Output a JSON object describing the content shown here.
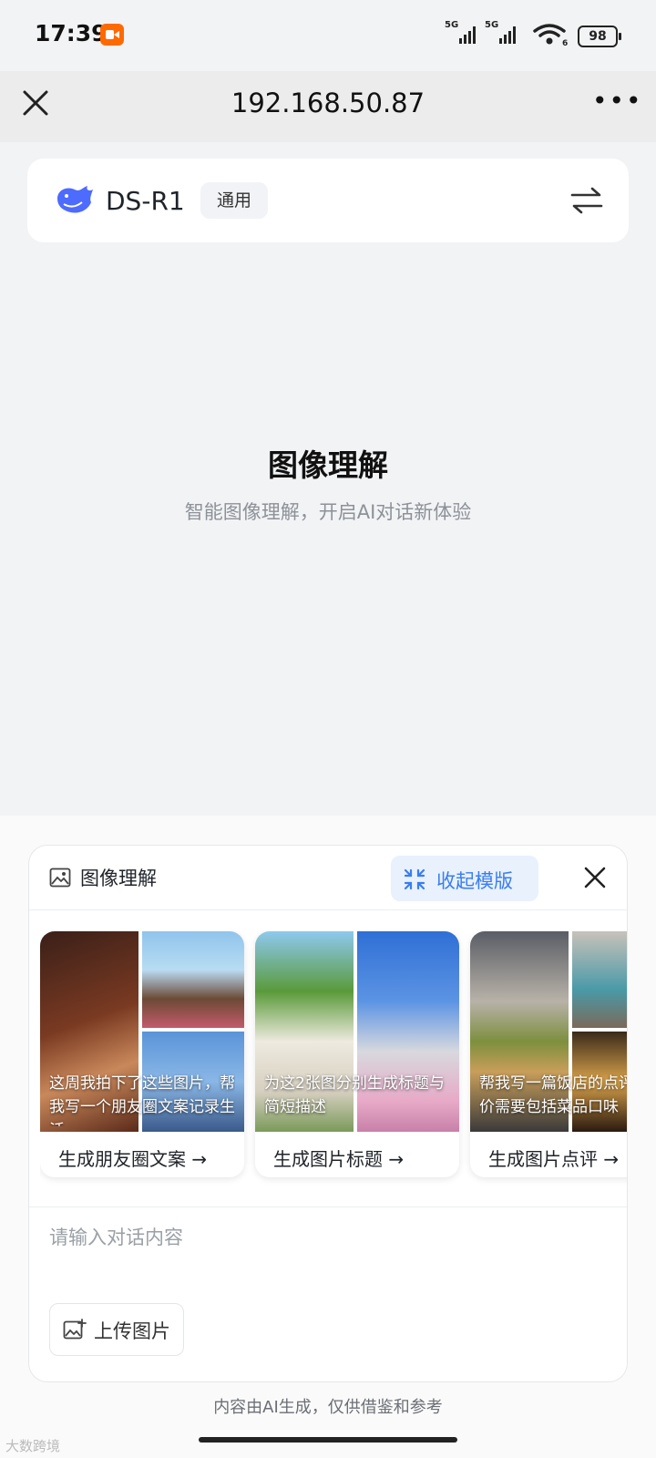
{
  "status_bar": {
    "time": "17:39",
    "signal1": "5G",
    "signal2": "5G",
    "wifi_sub": "6",
    "battery": "98"
  },
  "browser": {
    "url": "192.168.50.87"
  },
  "model": {
    "name": "DS-R1",
    "tag": "通用"
  },
  "hero": {
    "title": "图像理解",
    "subtitle": "智能图像理解，开启AI对话新体验"
  },
  "panel": {
    "title": "图像理解",
    "collapse_label": "收起模版",
    "templates": [
      {
        "caption": "这周我拍下了这些图片，帮我写一个朋友圈文案记录生活",
        "label": "生成朋友圈文案 →"
      },
      {
        "caption": "为这2张图分别生成标题与简短描述",
        "label": "生成图片标题 →"
      },
      {
        "caption": "帮我写一篇饭店的点评，评价需要包括菜品口味",
        "label": "生成图片点评 →"
      }
    ],
    "input_placeholder": "请输入对话内容",
    "upload_label": "上传图片"
  },
  "footer": {
    "disclaimer": "内容由AI生成，仅供借鉴和参考",
    "watermark": "大数跨境"
  }
}
